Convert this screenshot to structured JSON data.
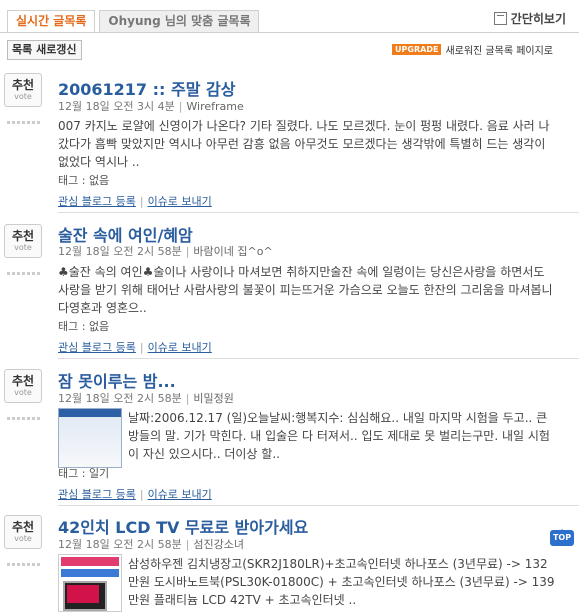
{
  "tabs": {
    "realtime": "실시간 글목록",
    "custom": "Ohyung 님의 맞춤 글목록"
  },
  "simple_view": "간단히보기",
  "refresh": "목록 새로갱신",
  "upgrade": {
    "badge": "UPGRADE",
    "text": "새로워진 글목록 페이지로"
  },
  "vote": {
    "label": "추천",
    "sub": "vote"
  },
  "actions": {
    "subscribe": "관심 블로그 등록",
    "send": "이슈로 보내기"
  },
  "posts": [
    {
      "title": "20061217 :: 주말 감상",
      "date": "12월 18일 오전 3시 4분",
      "blog": "Wireframe",
      "text": "007 카지노 로얄에 신영이가 나온다? 기타 질렸다. 나도 모르겠다. 눈이 펑펑 내렸다. 음료 사러 나갔다가 흠빡 맞았지만 역시나 아무런 감흥 없음 아무것도 모르겠다는 생각밖에 특별히 드는 생각이 없었다 역시나 ..",
      "tag": "태그 : 없음"
    },
    {
      "title": "술잔 속에 여인/혜암",
      "date": "12월 18일 오전 2시 58분",
      "blog": "바람이네 집^o^",
      "text": "♣술잔 속의 여인♣술이나 사랑이나 마셔보면 취하지만술잔 속에 일렁이는 당신은사랑을 하면서도 사랑을 받기 위해 태어난 사람사랑의 불꽃이 피는뜨거운 가슴으로 오늘도 한잔의 그리움을 마셔봅니다영혼과 영혼으..",
      "tag": "태그 : 없음"
    },
    {
      "title": "잠 못이루는 밤...",
      "date": "12월 18일 오전 2시 58분",
      "blog": "비밀정원",
      "text": "날짜:2006.12.17 (일)오늘날씨:행복지수: 심심해요.. 내일 마지막 시험을 두고.. 큰방들의 말. 기가 막힌다. 내 입술은 다 터져서.. 입도 제대로 못 벌리는구만. 내일 시험이 자신 있으시다.. 더이상 할..",
      "tag": "태그 : 일기"
    },
    {
      "title": "42인치 LCD TV 무료로 받아가세요",
      "date": "12월 18일 오전 2시 58분",
      "blog": "섬진강소녀",
      "text": "삼성하우젠 김치냉장고(SKR2J180LR)+초고속인터넷 하나포스 (3년무료) -> 132만원 도시바노트북(PSL30K-01800C) + 초고속인터넷 하나포스 (3년무료) -> 139만원 플래티늄 LCD 42TV + 초고속인터넷 .."
    }
  ],
  "top_button": "TOP"
}
